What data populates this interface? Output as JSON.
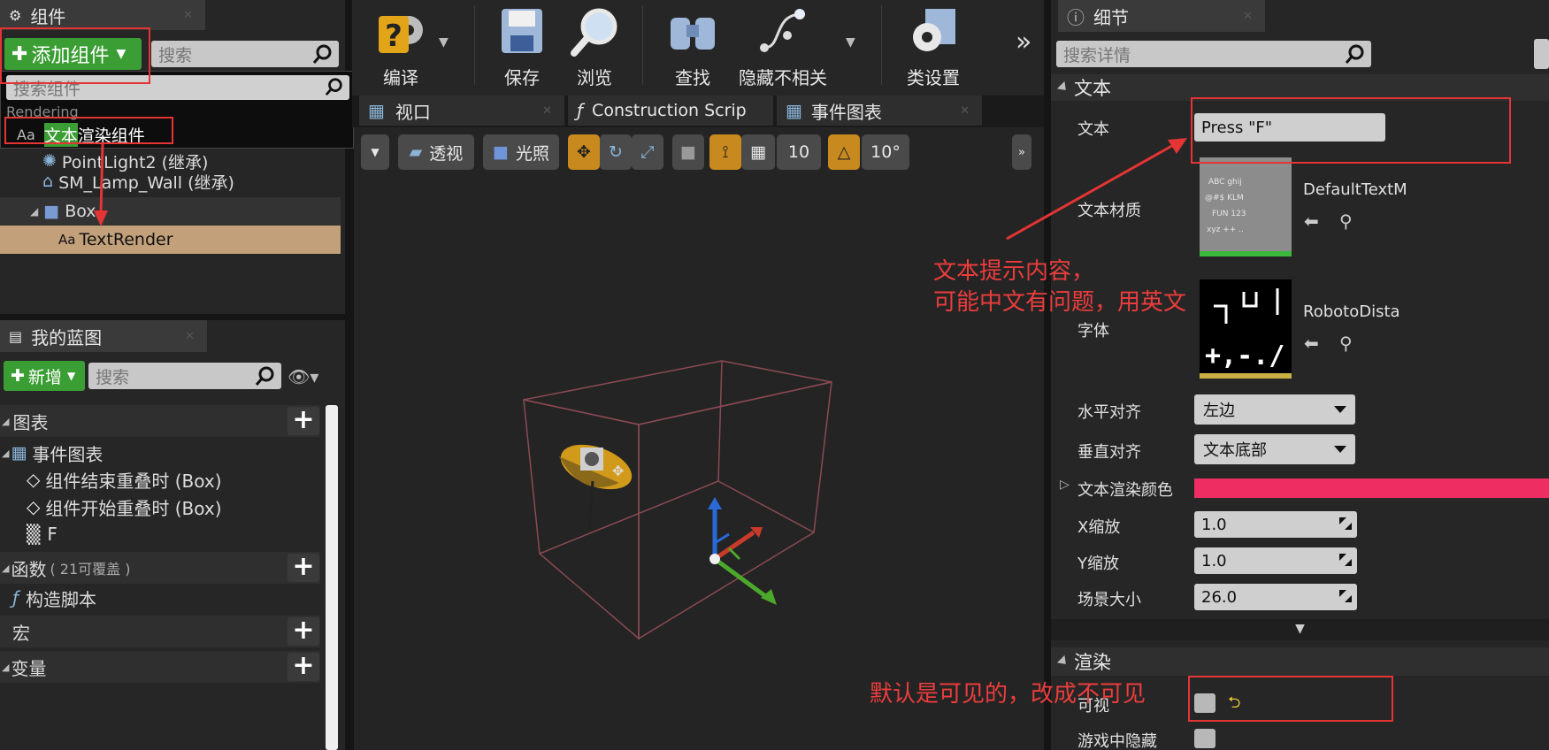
{
  "components_panel": {
    "tab_title": "组件",
    "add_component_label": "添加组件",
    "search_placeholder": "搜索",
    "dropdown_search_placeholder": "搜索组件",
    "category": "Rendering",
    "result_highlight": "文本",
    "result_rest": "渲染组件",
    "tree": [
      {
        "label": "PointLight2 (继承)"
      },
      {
        "label": "SM_Lamp_Wall (继承)"
      },
      {
        "label": "Box"
      },
      {
        "label": "TextRender"
      }
    ]
  },
  "my_blueprint": {
    "tab_title": "我的蓝图",
    "new_label": "新增",
    "search_placeholder": "搜索",
    "graphs_label": "图表",
    "event_graph_label": "事件图表",
    "events": [
      "组件结束重叠时 (Box)",
      "组件开始重叠时 (Box)",
      "F"
    ],
    "functions_label": "函数",
    "functions_note": "( 21可覆盖 )",
    "construction_script": "构造脚本",
    "macros_label": "宏",
    "variables_label": "变量"
  },
  "toolbar": {
    "compile": "编译",
    "save": "保存",
    "browse": "浏览",
    "find": "查找",
    "hide_unrelated": "隐藏不相关",
    "class_settings": "类设置"
  },
  "editor_tabs": [
    "视口",
    "Construction Scrip",
    "事件图表"
  ],
  "viewport_toolbar": {
    "perspective": "透视",
    "lit": "光照",
    "grid_snap": "10",
    "rotate_snap": "10°"
  },
  "details": {
    "tab_title": "细节",
    "search_placeholder": "搜索详情",
    "text_section": "文本",
    "text_label": "文本",
    "text_value": "Press \"F\"",
    "text_material_label": "文本材质",
    "text_material_value": "DefaultTextM",
    "font_label": "字体",
    "font_value": "RobotoDista",
    "h_align_label": "水平对齐",
    "h_align_value": "左边",
    "v_align_label": "垂直对齐",
    "v_align_value": "文本底部",
    "color_label": "文本渲染颜色",
    "color_value": "#ee2e63",
    "x_scale_label": "X缩放",
    "x_scale_value": "1.0",
    "y_scale_label": "Y缩放",
    "y_scale_value": "1.0",
    "world_size_label": "场景大小",
    "world_size_value": "26.0",
    "render_section": "渲染",
    "visible_label": "可视",
    "hidden_in_game_label": "游戏中隐藏"
  },
  "annotations": {
    "note_text_line1": "文本提示内容，",
    "note_text_line2": "可能中文有问题，用英文",
    "note_visible": "默认是可见的，改成不可见"
  },
  "colors": {
    "highlight_red": "#e43434",
    "accent_green": "#3b9e34",
    "selected_row": "#c2a07a"
  }
}
